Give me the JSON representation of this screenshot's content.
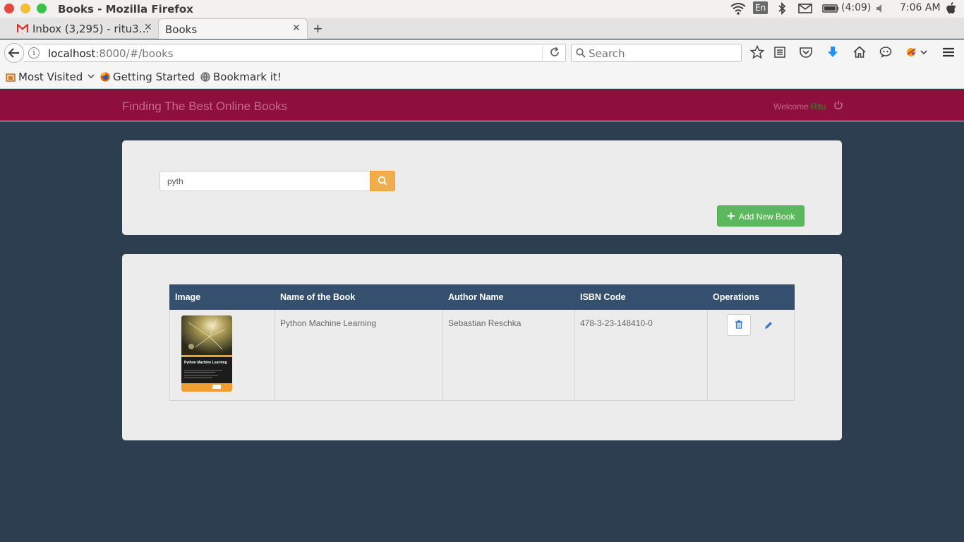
{
  "os": {
    "window_title": "Books - Mozilla Firefox",
    "keyboard_layout": "En",
    "battery": "(4:09)",
    "clock": "7:06 AM"
  },
  "browser": {
    "tabs": [
      {
        "label": "Inbox (3,295) - ritu3…",
        "icon": "gmail-icon",
        "active": false
      },
      {
        "label": "Books",
        "active": true
      }
    ],
    "url_host": "localhost",
    "url_path": ":8000/#/books",
    "search_placeholder": "Search",
    "bookmarks": [
      {
        "label": "Most Visited",
        "icon": "folder-icon"
      },
      {
        "label": "Getting Started",
        "icon": "firefox-icon"
      },
      {
        "label": "Bookmark it!",
        "icon": "globe-icon"
      }
    ]
  },
  "app": {
    "brand": "Finding The Best Online Books",
    "welcome_label": "Welcome",
    "username": "Ritu",
    "search_value": "pyth",
    "add_button_label": "Add New Book",
    "table": {
      "headers": [
        "Image",
        "Name of the Book",
        "Author Name",
        "ISBN Code",
        "Operations"
      ],
      "rows": [
        {
          "cover_title": "Python Machine Learning",
          "name": "Python Machine Learning",
          "author": "Sebastian Reschka",
          "isbn": "478-3-23-148410-0"
        }
      ]
    }
  },
  "colors": {
    "header_bg": "#8e0e3c",
    "page_bg": "#2c3e50",
    "table_header_bg": "#34506e",
    "add_button": "#5cb85c",
    "search_button": "#f0ad4e"
  }
}
